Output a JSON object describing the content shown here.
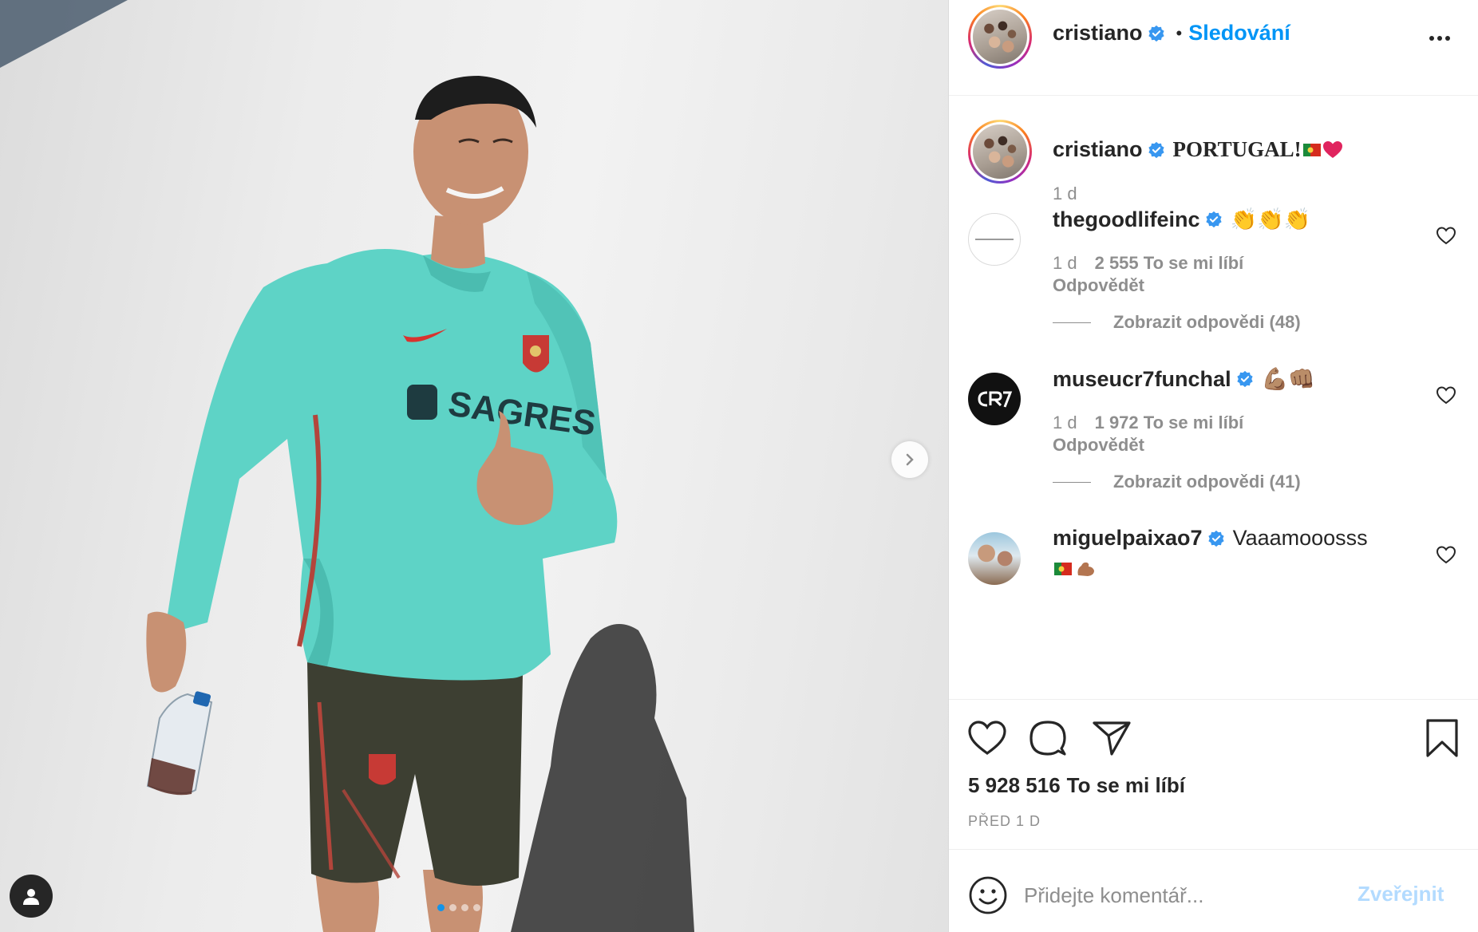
{
  "header": {
    "username": "cristiano",
    "separator": "•",
    "follow_label": "Sledování",
    "more_icon": "more-horizontal-icon"
  },
  "photo": {
    "jersey_brand": "SAGRES",
    "carousel": {
      "total": 4,
      "active": 1
    }
  },
  "caption": {
    "username": "cristiano",
    "text": "PORTUGAL!",
    "emoji": [
      "portugal-flag",
      "red-heart"
    ],
    "time": "1 d"
  },
  "comments": [
    {
      "username": "thegoodlifeinc",
      "verified": true,
      "text": "👏👏👏",
      "time": "1 d",
      "likes": "2 555 To se mi líbí",
      "reply_label": "Odpovědět",
      "view_replies": "Zobrazit odpovědi (48)"
    },
    {
      "username": "museucr7funchal",
      "verified": true,
      "text": "💪🏽👊🏽",
      "time": "1 d",
      "likes": "1 972 To se mi líbí",
      "reply_label": "Odpovědět",
      "view_replies": "Zobrazit odpovědi (41)"
    },
    {
      "username": "miguelpaixao7",
      "verified": true,
      "text": "Vaaamooosss"
    }
  ],
  "actions": {
    "like_count": "5 928 516",
    "like_label": "To se mi líbí",
    "time_ago": "PŘED 1 D"
  },
  "add_comment": {
    "placeholder": "Přidejte komentář...",
    "post_label": "Zveřejnit"
  },
  "colors": {
    "link_blue": "#0095f6",
    "post_disabled": "#b3dbff",
    "jersey_teal": "#5ed3c6",
    "text_primary": "#262626",
    "text_secondary": "#8e8e8e"
  }
}
